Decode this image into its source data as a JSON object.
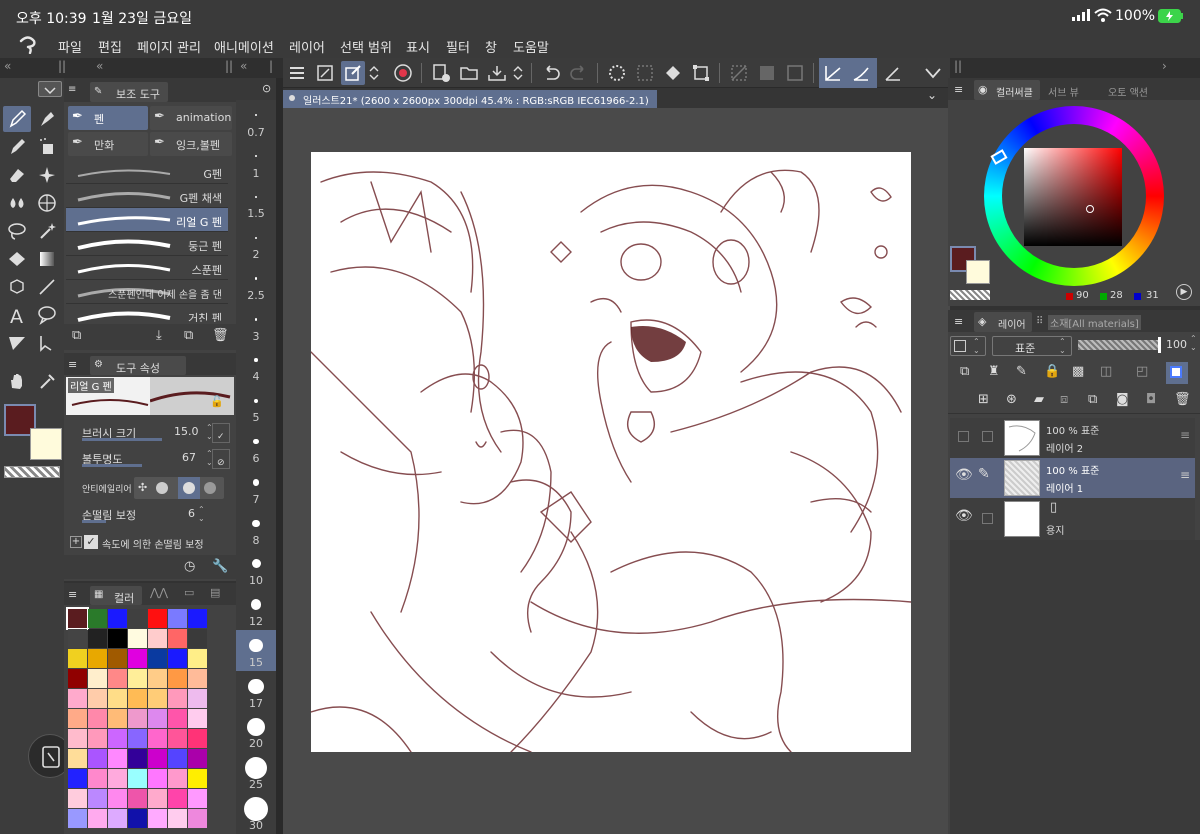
{
  "status": {
    "time": "오후 10:39",
    "date": "1월 23일 금요일",
    "battery": "100%"
  },
  "menu": [
    "파일",
    "편집",
    "페이지 관리",
    "애니메이션",
    "레이어",
    "선택 범위",
    "표시",
    "필터",
    "창",
    "도움말"
  ],
  "document": {
    "tab_title": "일러스트21* (2600 x 2600px 300dpi 45.4% : RGB:sRGB IEC61966-2.1)"
  },
  "subtool": {
    "header": "보조 도구",
    "groups": [
      "펜",
      "animation",
      "만화",
      "잉크,볼펜"
    ],
    "brushes": [
      "G펜",
      "G펜 채색",
      "리얼 G 펜",
      "둥근 펜",
      "스푼펜",
      "스푼펜인데 이제 손을 좀 댄",
      "거친 펜"
    ]
  },
  "tool_property": {
    "header": "도구 속성",
    "preview_name": "리얼 G 펜",
    "brush_size_label": "브러시 크기",
    "brush_size": "15.0",
    "opacity_label": "불투명도",
    "opacity": "67",
    "antialias_label": "안티에일리어",
    "stabilization_label": "손떨림 보정",
    "stabilization": "6",
    "speed_stab_label": "속도에 의한 손떨림 보정"
  },
  "brush_sizes": [
    "0.7",
    "1",
    "1.5",
    "2",
    "2.5",
    "3",
    "4",
    "5",
    "6",
    "7",
    "8",
    "10",
    "12",
    "15",
    "17",
    "20",
    "25",
    "30"
  ],
  "color_panel": {
    "header": "컬러",
    "tabs": [
      "컬러써클",
      "서브 뷰",
      "오토 액션"
    ],
    "r": "90",
    "g": "28",
    "b": "31"
  },
  "colors": {
    "main": "#5a1c1f",
    "sub": "#fffbdc",
    "accent": "#5f6f8f"
  },
  "palette": [
    [
      "#5a1c1f",
      "#2a7a2a",
      "#1a1aff",
      "#404040",
      "#ff1010",
      "#7a7aff",
      "#1a1aff"
    ],
    [
      "#444444",
      "#222222",
      "#000000",
      "#fffbe0",
      "#ffcccc",
      "#ff6666",
      "#3a3a3a"
    ],
    [
      "#f0d020",
      "#e8a800",
      "#a05a00",
      "#e000e0",
      "#0a3aa0",
      "#1a1aff",
      "#ffee88"
    ],
    [
      "#900000",
      "#ffeecc",
      "#ff8888",
      "#ffee99",
      "#ffcc88",
      "#ff9944",
      "#ffbb99"
    ],
    [
      "#ffaacc",
      "#ffccaa",
      "#ffdd88",
      "#ffbb55",
      "#ffcc77",
      "#ff99bb",
      "#eebbee"
    ],
    [
      "#ffaa88",
      "#ff88aa",
      "#ffbb77",
      "#ee99cc",
      "#dd88ee",
      "#ff55aa",
      "#ffccee"
    ],
    [
      "#ffbbcc",
      "#ff99bb",
      "#cc66ff",
      "#8866ff",
      "#ff66cc",
      "#ff5599",
      "#ff3377"
    ],
    [
      "#ffdd99",
      "#aa55ff",
      "#ff88ff",
      "#330099",
      "#cc00cc",
      "#5544ff",
      "#aa00aa"
    ],
    [
      "#2222ff",
      "#ff88cc",
      "#ffaadd",
      "#99ffff",
      "#ff77ff",
      "#ff99cc",
      "#ffee00"
    ],
    [
      "#ffccdd",
      "#bb88ff",
      "#ff88ee",
      "#ee55aa",
      "#ffaacc",
      "#ff44aa",
      "#ff99ff"
    ],
    [
      "#9999ff",
      "#ffaaee",
      "#ddaaff",
      "#1111aa",
      "#ffaaff",
      "#ffccee",
      "#ee88dd"
    ]
  ],
  "layer_panel": {
    "header": "레이어",
    "material_tab": "소재[All materials]",
    "blend_mode": "표준",
    "opacity": "100",
    "layers": [
      {
        "info": "100 % 표준",
        "name": "레이어 2"
      },
      {
        "info": "100 % 표준",
        "name": "레이어 1"
      },
      {
        "info": "",
        "name": "용지"
      }
    ]
  }
}
